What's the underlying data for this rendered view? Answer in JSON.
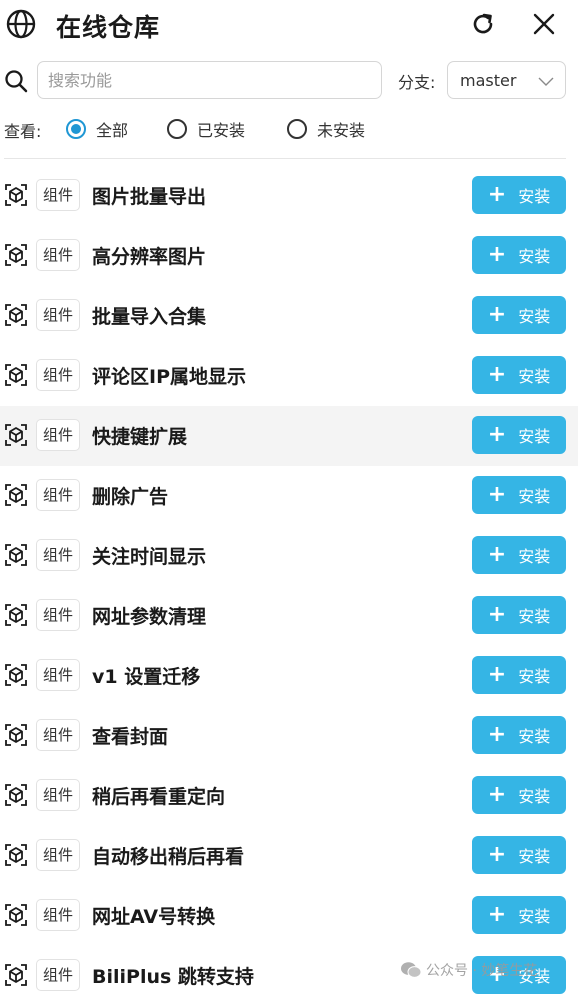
{
  "header": {
    "title": "在线仓库",
    "globe_icon": "globe-icon",
    "refresh_icon": "refresh-icon",
    "close_icon": "close-icon"
  },
  "search": {
    "placeholder": "搜索功能",
    "value": "",
    "icon": "search-icon"
  },
  "branch": {
    "label": "分支:",
    "value": "master"
  },
  "filter": {
    "label": "查看:",
    "options": [
      {
        "label": "全部",
        "checked": true
      },
      {
        "label": "已安装",
        "checked": false
      },
      {
        "label": "未安装",
        "checked": false
      }
    ]
  },
  "items": [
    {
      "type": "组件",
      "name": "图片批量导出",
      "action": "安装"
    },
    {
      "type": "组件",
      "name": "高分辨率图片",
      "action": "安装"
    },
    {
      "type": "组件",
      "name": "批量导入合集",
      "action": "安装"
    },
    {
      "type": "组件",
      "name": "评论区IP属地显示",
      "action": "安装"
    },
    {
      "type": "组件",
      "name": "快捷键扩展",
      "action": "安装"
    },
    {
      "type": "组件",
      "name": "删除广告",
      "action": "安装"
    },
    {
      "type": "组件",
      "name": "关注时间显示",
      "action": "安装"
    },
    {
      "type": "组件",
      "name": "网址参数清理",
      "action": "安装"
    },
    {
      "type": "组件",
      "name": "v1 设置迁移",
      "action": "安装"
    },
    {
      "type": "组件",
      "name": "查看封面",
      "action": "安装"
    },
    {
      "type": "组件",
      "name": "稍后再看重定向",
      "action": "安装"
    },
    {
      "type": "组件",
      "name": "自动移出稍后再看",
      "action": "安装"
    },
    {
      "type": "组件",
      "name": "网址AV号转换",
      "action": "安装"
    },
    {
      "type": "组件",
      "name": "BiliPlus 跳转支持",
      "action": "安装"
    }
  ],
  "watermark": {
    "text": "公众号 · 妙笔生花"
  },
  "colors": {
    "accent": "#35b5e5",
    "radio_checked": "#1f97d4"
  }
}
